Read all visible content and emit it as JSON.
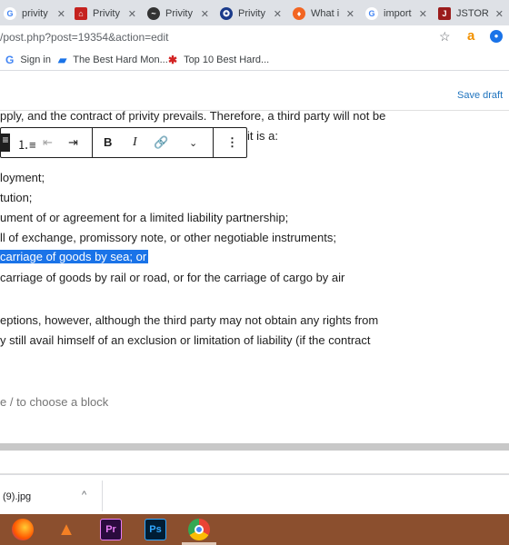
{
  "tabs": [
    {
      "label": "privity",
      "icon": "google-icon",
      "color": "#4285f4"
    },
    {
      "label": "Privity",
      "icon": "bookmark-icon",
      "color": "#c5221f"
    },
    {
      "label": "Privity",
      "icon": "swirl-icon",
      "color": "#333333"
    },
    {
      "label": "Privity",
      "icon": "seal-icon",
      "color": "#1a3a8a"
    },
    {
      "label": "What i",
      "icon": "flame-icon",
      "color": "#f26522"
    },
    {
      "label": "import",
      "icon": "google-icon",
      "color": "#4285f4"
    },
    {
      "label": "JSTOR",
      "icon": "jstor-icon",
      "color": "#9b1c1c"
    }
  ],
  "address": {
    "url": "/post.php?post=19354&action=edit"
  },
  "bookmarks": [
    {
      "label": "Sign in",
      "icon": "google-icon"
    },
    {
      "label": "The Best Hard Mon...",
      "icon": "tag-icon"
    },
    {
      "label": "Top 10 Best Hard...",
      "icon": "yelp-icon"
    }
  ],
  "editor": {
    "save_draft": "Save draft",
    "partial_top": "pply, and the contract of privity prevails. Therefore, a third party will not be",
    "line_it_is": "it is a:",
    "items": [
      "loyment;",
      "tution;",
      "ument of or agreement for a limited liability partnership;",
      "ll of exchange, promissory note, or other negotiable instruments;",
      "carriage of goods by sea; or",
      "carriage of goods by rail or road, or for the carriage of cargo by air"
    ],
    "para2_l1": "eptions, however, although the third party may not obtain any rights from",
    "para2_l2": "y still avail himself of an exclusion or limitation of liability (if the contract",
    "placeholder": "e / to choose a block"
  },
  "toolbar": {
    "list_label": "≡",
    "bold": "B",
    "italic": "I",
    "more": "⋮"
  },
  "downloads": {
    "file": "(9).jpg"
  },
  "taskbar": [
    {
      "name": "firefox"
    },
    {
      "name": "vlc"
    },
    {
      "name": "premiere",
      "label": "Pr"
    },
    {
      "name": "photoshop",
      "label": "Ps"
    },
    {
      "name": "chrome"
    }
  ]
}
